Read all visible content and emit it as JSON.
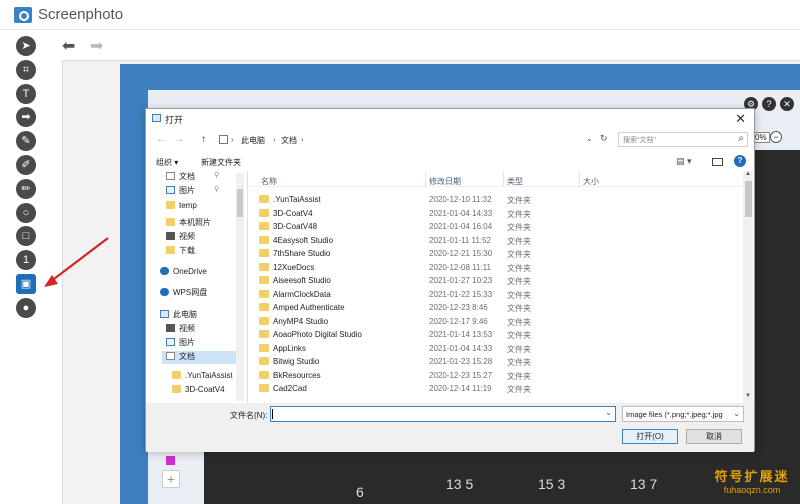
{
  "app": {
    "title": "Screenphoto"
  },
  "toolbar": {
    "tools": [
      {
        "name": "arrow-tool",
        "icon": "arrow-icon",
        "glyph": "➤",
        "active": false
      },
      {
        "name": "crop-tool",
        "icon": "crop-icon",
        "glyph": "⌗",
        "active": false
      },
      {
        "name": "text-tool",
        "icon": "text-icon",
        "glyph": "T",
        "active": false
      },
      {
        "name": "arrow-right-tool",
        "icon": "arrow-right-icon",
        "glyph": "➡",
        "active": false
      },
      {
        "name": "pen-tool",
        "icon": "pen-icon",
        "glyph": "✎",
        "active": false
      },
      {
        "name": "marker-tool",
        "icon": "marker-icon",
        "glyph": "✐",
        "active": false
      },
      {
        "name": "pencil-tool",
        "icon": "pencil-icon",
        "glyph": "✏",
        "active": false
      },
      {
        "name": "ellipse-tool",
        "icon": "ellipse-icon",
        "glyph": "○",
        "active": false
      },
      {
        "name": "rectangle-tool",
        "icon": "rectangle-icon",
        "glyph": "□",
        "active": false
      },
      {
        "name": "counter-tool",
        "icon": "counter-icon",
        "glyph": "1",
        "active": false
      },
      {
        "name": "image-tool",
        "icon": "image-icon",
        "glyph": "▣",
        "active": true
      },
      {
        "name": "blur-tool",
        "icon": "drop-icon",
        "glyph": "●",
        "active": false
      }
    ]
  },
  "history": {
    "undo_glyph": "⬅",
    "redo_glyph": "➡"
  },
  "canvas": {
    "zoom": "0%",
    "zoom_minus": "−",
    "dial_numbers": [
      "6",
      "13 5",
      "15 3",
      "13 7"
    ],
    "plus": "+",
    "top_icons": [
      "⚙",
      "?",
      "✕"
    ]
  },
  "watermark": {
    "main": "符号扩展迷",
    "sub": "fuhaoqzn.com"
  },
  "dialog": {
    "title": "打开",
    "close": "✕",
    "nav_back": "←",
    "nav_forward": "→",
    "nav_up": "↑",
    "breadcrumb": [
      "此电脑",
      "文档"
    ],
    "crumb_sep": "›",
    "refresh": "↻",
    "dropdown": "⌄",
    "search_placeholder": "搜索\"文档\"",
    "search_glyph": "⌕",
    "organize": "组织 ▾",
    "new_folder": "新建文件夹",
    "view_glyph": "▤ ▾",
    "help": "?",
    "nav_pane": [
      {
        "label": "文档",
        "icon": "doc",
        "pinned": true
      },
      {
        "label": "图片",
        "icon": "img",
        "pinned": true
      },
      {
        "label": "temp",
        "icon": "folder",
        "pinned": false
      },
      {
        "label": "本机照片",
        "icon": "folder",
        "pinned": false
      },
      {
        "label": "视频",
        "icon": "vid",
        "pinned": false
      },
      {
        "label": "下载",
        "icon": "dl",
        "pinned": false
      },
      {
        "label": "OneDrive",
        "icon": "cloud",
        "pinned": false
      },
      {
        "label": "WPS网盘",
        "icon": "cloud",
        "pinned": false
      },
      {
        "label": "此电脑",
        "icon": "pc",
        "pinned": false
      },
      {
        "label": "视频",
        "icon": "vid",
        "pinned": false
      },
      {
        "label": "图片",
        "icon": "img",
        "pinned": false
      },
      {
        "label": "文档",
        "icon": "doc",
        "pinned": false,
        "selected": true
      },
      {
        "label": ".YunTaiAssist",
        "icon": "folder",
        "pinned": false
      },
      {
        "label": "3D-CoatV4",
        "icon": "folder",
        "pinned": false
      }
    ],
    "pin_glyph": "📌",
    "columns": {
      "name": "名称",
      "date": "修改日期",
      "type": "类型",
      "size": "大小"
    },
    "files": [
      {
        "name": ".YunTaiAssist",
        "date": "2020-12-10 11:32",
        "type": "文件夹"
      },
      {
        "name": "3D-CoatV4",
        "date": "2021-01-04 14:33",
        "type": "文件夹"
      },
      {
        "name": "3D-CoatV48",
        "date": "2021-01-04 16:04",
        "type": "文件夹"
      },
      {
        "name": "4Easysoft Studio",
        "date": "2021-01-11 11:52",
        "type": "文件夹"
      },
      {
        "name": "7thShare Studio",
        "date": "2020-12-21 15:30",
        "type": "文件夹"
      },
      {
        "name": "12XueDocs",
        "date": "2020-12-08 11:11",
        "type": "文件夹"
      },
      {
        "name": "Aiseesoft Studio",
        "date": "2021-01-27 10:23",
        "type": "文件夹"
      },
      {
        "name": "AlarmClockData",
        "date": "2021-01-22 15:33",
        "type": "文件夹"
      },
      {
        "name": "Amped Authenticate",
        "date": "2020-12-23 8:46",
        "type": "文件夹"
      },
      {
        "name": "AnyMP4 Studio",
        "date": "2020-12-17 9:46",
        "type": "文件夹"
      },
      {
        "name": "AoaoPhoto Digital Studio",
        "date": "2021-01-14 13:53",
        "type": "文件夹"
      },
      {
        "name": "AppLinks",
        "date": "2021-01-04 14:33",
        "type": "文件夹"
      },
      {
        "name": "Bitwig Studio",
        "date": "2021-01-23 15:28",
        "type": "文件夹"
      },
      {
        "name": "BkResources",
        "date": "2020-12-23 15:27",
        "type": "文件夹"
      },
      {
        "name": "Cad2Cad",
        "date": "2020-12-14 11:19",
        "type": "文件夹"
      }
    ],
    "filename_label": "文件名(N):",
    "filename_value": "",
    "filter": "Image files (*.png;*.jpeg;*.jpg",
    "open_button": "打开(O)",
    "cancel_button": "取消"
  },
  "colors": {
    "accent": "#1e6fb8",
    "canvas_blue": "#3f7fbf",
    "arrow_red": "#d42424",
    "folder": "#f3cf6a"
  }
}
